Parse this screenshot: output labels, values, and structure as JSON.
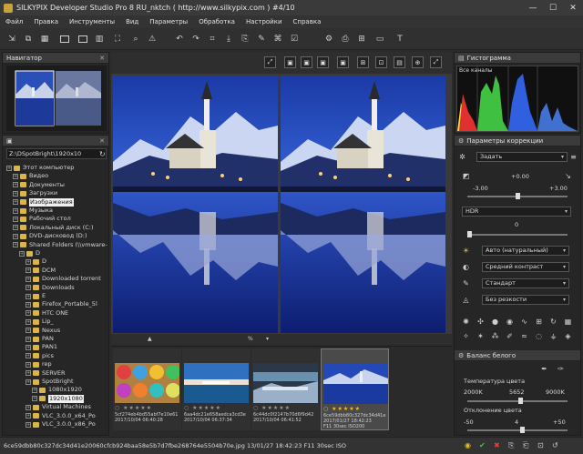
{
  "window": {
    "title": "SILKYPIX Developer Studio Pro 8 RU_nktch ( http://www.silkypix.com )   #4/10",
    "minimize": "—",
    "maximize": "☐",
    "close": "✕"
  },
  "menu": [
    "Файл",
    "Правка",
    "Инструменты",
    "Вид",
    "Параметры",
    "Обработка",
    "Настройки",
    "Справка"
  ],
  "navigator": {
    "title": "Навигатор"
  },
  "folders": {
    "path": "Z:\\DSpotBright\\1920x10",
    "items": [
      {
        "label": "Этот компьютер",
        "indent": 0
      },
      {
        "label": "Видео",
        "indent": 1
      },
      {
        "label": "Документы",
        "indent": 1
      },
      {
        "label": "Загрузки",
        "indent": 1
      },
      {
        "label": "Изображения",
        "indent": 1
      },
      {
        "label": "Музыка",
        "indent": 1
      },
      {
        "label": "Рабочий стол",
        "indent": 1
      },
      {
        "label": "Локальный диск (C:)",
        "indent": 1
      },
      {
        "label": "DVD-дисковод (D:)",
        "indent": 1
      },
      {
        "label": "Shared Folders (\\\\vmware-",
        "indent": 1
      },
      {
        "label": "D",
        "indent": 2
      },
      {
        "label": "D",
        "indent": 3
      },
      {
        "label": "DCM",
        "indent": 3
      },
      {
        "label": "Downloaded torrent",
        "indent": 3
      },
      {
        "label": "Downloads",
        "indent": 3
      },
      {
        "label": "E",
        "indent": 3
      },
      {
        "label": "Firefox_Portable_5l",
        "indent": 3
      },
      {
        "label": "HTC ONE",
        "indent": 3
      },
      {
        "label": "Lip_",
        "indent": 3
      },
      {
        "label": "Nexus",
        "indent": 3
      },
      {
        "label": "PAN",
        "indent": 3
      },
      {
        "label": "PAN1",
        "indent": 3
      },
      {
        "label": "pics",
        "indent": 3
      },
      {
        "label": "rep",
        "indent": 3
      },
      {
        "label": "SERVER",
        "indent": 3
      },
      {
        "label": "SpotBright",
        "indent": 3
      },
      {
        "label": "1080x1920",
        "indent": 4
      },
      {
        "label": "1920x1080",
        "indent": 4
      },
      {
        "label": "Virtual Machines",
        "indent": 3
      },
      {
        "label": "VLC_3.0.0_x64_Po",
        "indent": 3
      },
      {
        "label": "VLC_3.0.0_x86_Po",
        "indent": 3
      }
    ]
  },
  "viewer": {
    "zoom_label": "%"
  },
  "thumbnails": [
    {
      "stars": "○ ★★★★★",
      "line1": "5cf274eb4bd55abf7e10e61",
      "line2": "2017/10/04 06:40:28",
      "gold": false,
      "selected": false
    },
    {
      "stars": "○ ★★★★★",
      "line1": "6aa4dc21e658aedca3cd3e",
      "line2": "2017/10/04 06:37:34",
      "gold": false,
      "selected": false
    },
    {
      "stars": "○ ★★★★★",
      "line1": "6c44dc0f2147b70d6f9d42",
      "line2": "2017/10/04 06:41:52",
      "gold": false,
      "selected": false
    },
    {
      "stars": "○ ★★★★★",
      "line1": "6ce59dbb80c327dc34d41e",
      "line2": "2017/01/27 18:42:23",
      "line3": "F11 30sec ISO200",
      "gold": true,
      "selected": true
    }
  ],
  "histogram": {
    "title": "Гистограмма",
    "channel": "Все каналы"
  },
  "correction": {
    "title": "Параметры коррекции",
    "preset": "Задать",
    "exposure_value": "+0.00",
    "exposure_min": "-3.00",
    "exposure_max": "+3.00",
    "hdr_label": "HDR",
    "hdr_value": "0",
    "white_balance_mode": "Авто (натуральный)",
    "contrast": "Средний контраст",
    "color": "Стандарт",
    "sharpness": "Без резкости",
    "wb_title": "Баланс белого",
    "temp_label": "Температура цвета",
    "temp_min": "2000K",
    "temp_value": "5652",
    "temp_max": "9000K",
    "tint_label": "Отклонение цвета",
    "tint_min": "-50",
    "tint_value": "4",
    "tint_max": "+50"
  },
  "status": "6ce59dbb80c327dc34d41e20060cfcb924baa58e5b7d7fbe268764e5504b70e.jpg  13/01/27 18:42:23 F11 30sec ISO"
}
